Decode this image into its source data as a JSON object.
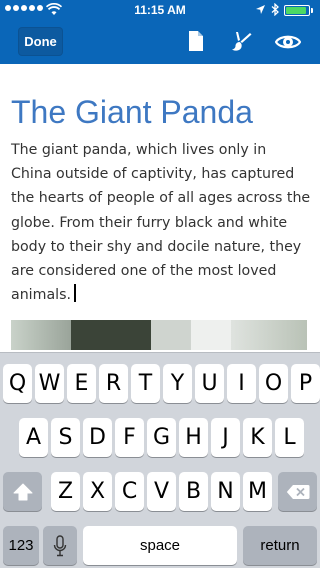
{
  "status_bar": {
    "time": "11:15 AM",
    "signal_icon": "signal-dots-icon",
    "wifi_icon": "wifi-icon",
    "location_icon": "location-arrow-icon",
    "bluetooth_icon": "bluetooth-icon",
    "battery_icon": "battery-icon",
    "battery_level": 0.9,
    "battery_color": "#4cd964"
  },
  "toolbar": {
    "done_label": "Done",
    "icons": [
      "document-icon",
      "brush-icon",
      "eye-icon"
    ],
    "bar_color": "#0a66b8"
  },
  "document": {
    "title": "The Giant Panda",
    "title_color": "#3e78c2",
    "body": "The giant panda, which lives only in China outside of captivity, has captured the hearts of people of all ages across the globe. From their furry black and white body to their shy and docile nature, they are considered one of the most loved animals."
  },
  "keyboard": {
    "row1": [
      "Q",
      "W",
      "E",
      "R",
      "T",
      "Y",
      "U",
      "I",
      "O",
      "P"
    ],
    "row2": [
      "A",
      "S",
      "D",
      "F",
      "G",
      "H",
      "J",
      "K",
      "L"
    ],
    "row3": [
      "Z",
      "X",
      "C",
      "V",
      "B",
      "N",
      "M"
    ],
    "numbers_label": "123",
    "space_label": "space",
    "return_label": "return",
    "icons": [
      "shift-icon",
      "backspace-icon",
      "microphone-icon"
    ]
  }
}
